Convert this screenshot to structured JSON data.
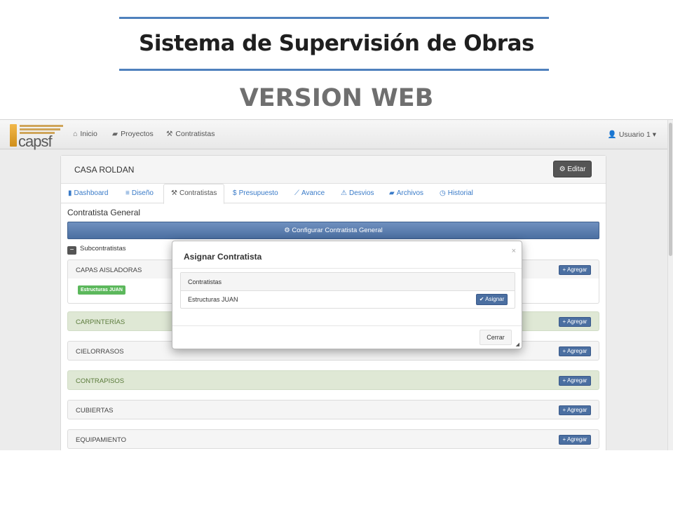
{
  "slide": {
    "title": "Sistema de Supervisión de Obras",
    "subtitle": "VERSION WEB"
  },
  "navbar": {
    "logo_text": "capsf",
    "items": [
      {
        "label": "Inicio",
        "icon": "home-icon"
      },
      {
        "label": "Proyectos",
        "icon": "folder-icon"
      },
      {
        "label": "Contratistas",
        "icon": "wrench-icon"
      }
    ],
    "user": {
      "label": "Usuario 1",
      "icon": "user-icon"
    }
  },
  "project": {
    "name": "CASA ROLDAN",
    "edit_label": "Editar",
    "tabs": [
      {
        "label": "Dashboard",
        "icon": "bookmark-icon"
      },
      {
        "label": "Diseño",
        "icon": "list-icon"
      },
      {
        "label": "Contratistas",
        "icon": "wrench-icon",
        "active": true
      },
      {
        "label": "Presupuesto",
        "icon": "dollar-icon"
      },
      {
        "label": "Avance",
        "icon": "chart-line-icon"
      },
      {
        "label": "Desvios",
        "icon": "warning-icon"
      },
      {
        "label": "Archivos",
        "icon": "folder-open-icon"
      },
      {
        "label": "Historial",
        "icon": "clock-icon"
      }
    ],
    "section_title": "Contratista General",
    "config_label": "Configurar Contratista General",
    "sub_label": "Subcontratistas",
    "add_label": "Agregar",
    "categories": [
      {
        "name": "CAPAS AISLADORAS",
        "tag": "Estructuras JUAN"
      },
      {
        "name": "CARPINTERÍAS"
      },
      {
        "name": "CIELORRASOS"
      },
      {
        "name": "CONTRAPISOS"
      },
      {
        "name": "CUBIERTAS"
      },
      {
        "name": "EQUIPAMIENTO"
      }
    ]
  },
  "modal": {
    "title": "Asignar Contratista",
    "close_symbol": "×",
    "table_header": "Contratistas",
    "row_name": "Estructuras JUAN",
    "assign_label": "Asignar",
    "cancel_label": "Cerrar"
  },
  "colors": {
    "accent_rule": "#4f81bd",
    "primary_button": "#4b6fa1",
    "success_tag": "#5cb85c",
    "highlight_row": "#dfe8d5"
  }
}
